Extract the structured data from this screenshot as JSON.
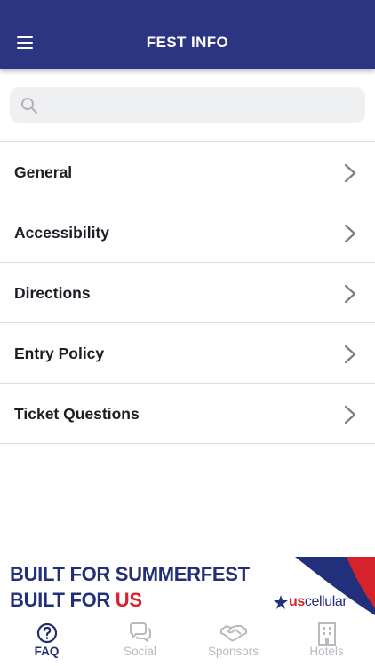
{
  "header": {
    "title": "FEST INFO"
  },
  "search": {
    "placeholder": ""
  },
  "faq_items": [
    {
      "label": "General"
    },
    {
      "label": "Accessibility"
    },
    {
      "label": "Directions"
    },
    {
      "label": "Entry Policy"
    },
    {
      "label": "Ticket Questions"
    }
  ],
  "ad": {
    "line1": "BUILT FOR SUMMERFEST",
    "line2_prefix": "BUILT FOR ",
    "line2_accent": "US",
    "brand_prefix": "us",
    "brand_suffix": "cellular"
  },
  "tabs": [
    {
      "label": "FAQ",
      "icon": "help-circle-icon",
      "active": true
    },
    {
      "label": "Social",
      "icon": "chat-bubbles-icon",
      "active": false
    },
    {
      "label": "Sponsors",
      "icon": "handshake-icon",
      "active": false
    },
    {
      "label": "Hotels",
      "icon": "building-icon",
      "active": false
    }
  ],
  "colors": {
    "primary_navy": "#2b3582",
    "accent_red": "#d6222b",
    "tab_inactive": "#b9b9bf",
    "divider": "#dcdcde"
  }
}
